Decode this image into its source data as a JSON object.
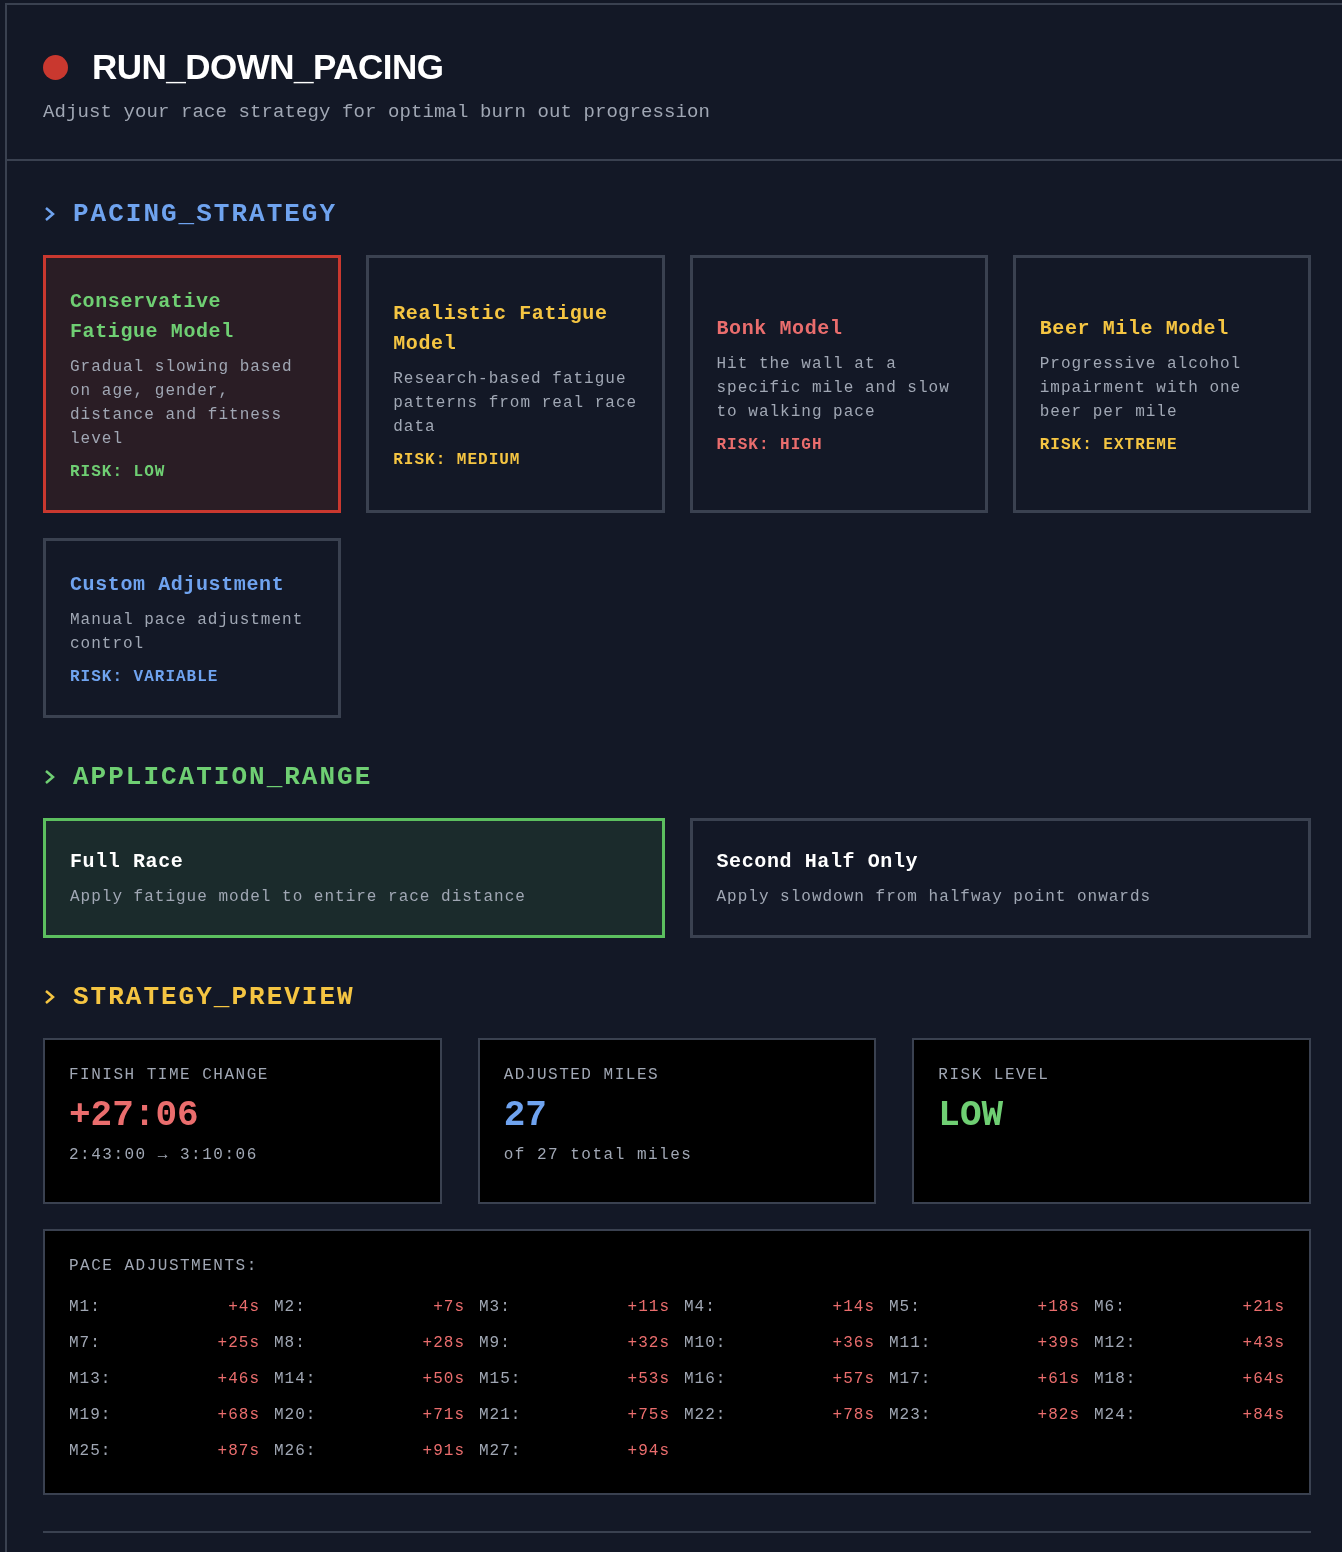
{
  "header": {
    "title": "RUN_DOWN_PACING",
    "subtitle": "Adjust your race strategy for optimal burn out progression"
  },
  "pacing_strategy": {
    "heading": "PACING_STRATEGY",
    "options": [
      {
        "title": "Conservative Fatigue Model",
        "description": "Gradual slowing based on age, gender, distance and fitness level",
        "risk": "RISK: LOW",
        "color": "#6fcf73",
        "selected": true
      },
      {
        "title": "Realistic Fatigue Model",
        "description": "Research-based fatigue patterns from real race data",
        "risk": "RISK: MEDIUM",
        "color": "#f5c542",
        "selected": false
      },
      {
        "title": "Bonk Model",
        "description": "Hit the wall at a specific mile and slow to walking pace",
        "risk": "RISK: HIGH",
        "color": "#ea6d6d",
        "selected": false
      },
      {
        "title": "Beer Mile Model",
        "description": "Progressive alcohol impairment with one beer per mile",
        "risk": "RISK: EXTREME",
        "color": "#f5c542",
        "selected": false
      },
      {
        "title": "Custom Adjustment",
        "description": "Manual pace adjustment control",
        "risk": "RISK: VARIABLE",
        "color": "#6fa3ef",
        "selected": false
      }
    ]
  },
  "application_range": {
    "heading": "APPLICATION_RANGE",
    "options": [
      {
        "title": "Full Race",
        "description": "Apply fatigue model to entire race distance",
        "selected": true
      },
      {
        "title": "Second Half Only",
        "description": "Apply slowdown from halfway point onwards",
        "selected": false
      }
    ]
  },
  "strategy_preview": {
    "heading": "STRATEGY_PREVIEW",
    "stats": [
      {
        "label": "FINISH TIME CHANGE",
        "value": "+27:06",
        "detail": "2:43:00 → 3:10:06",
        "color": "#ea6d6d"
      },
      {
        "label": "ADJUSTED MILES",
        "value": "27",
        "detail": "of 27 total miles",
        "color": "#6fa3ef"
      },
      {
        "label": "RISK LEVEL",
        "value": "LOW",
        "color": "#6fcf73"
      }
    ],
    "pace_adjustments": {
      "label": "PACE ADJUSTMENTS:",
      "items": [
        {
          "mile": "M1:",
          "delta": "+4s"
        },
        {
          "mile": "M2:",
          "delta": "+7s"
        },
        {
          "mile": "M3:",
          "delta": "+11s"
        },
        {
          "mile": "M4:",
          "delta": "+14s"
        },
        {
          "mile": "M5:",
          "delta": "+18s"
        },
        {
          "mile": "M6:",
          "delta": "+21s"
        },
        {
          "mile": "M7:",
          "delta": "+25s"
        },
        {
          "mile": "M8:",
          "delta": "+28s"
        },
        {
          "mile": "M9:",
          "delta": "+32s"
        },
        {
          "mile": "M10:",
          "delta": "+36s"
        },
        {
          "mile": "M11:",
          "delta": "+39s"
        },
        {
          "mile": "M12:",
          "delta": "+43s"
        },
        {
          "mile": "M13:",
          "delta": "+46s"
        },
        {
          "mile": "M14:",
          "delta": "+50s"
        },
        {
          "mile": "M15:",
          "delta": "+53s"
        },
        {
          "mile": "M16:",
          "delta": "+57s"
        },
        {
          "mile": "M17:",
          "delta": "+61s"
        },
        {
          "mile": "M18:",
          "delta": "+64s"
        },
        {
          "mile": "M19:",
          "delta": "+68s"
        },
        {
          "mile": "M20:",
          "delta": "+71s"
        },
        {
          "mile": "M21:",
          "delta": "+75s"
        },
        {
          "mile": "M22:",
          "delta": "+78s"
        },
        {
          "mile": "M23:",
          "delta": "+82s"
        },
        {
          "mile": "M24:",
          "delta": "+84s"
        },
        {
          "mile": "M25:",
          "delta": "+87s"
        },
        {
          "mile": "M26:",
          "delta": "+91s"
        },
        {
          "mile": "M27:",
          "delta": "+94s"
        }
      ]
    }
  }
}
